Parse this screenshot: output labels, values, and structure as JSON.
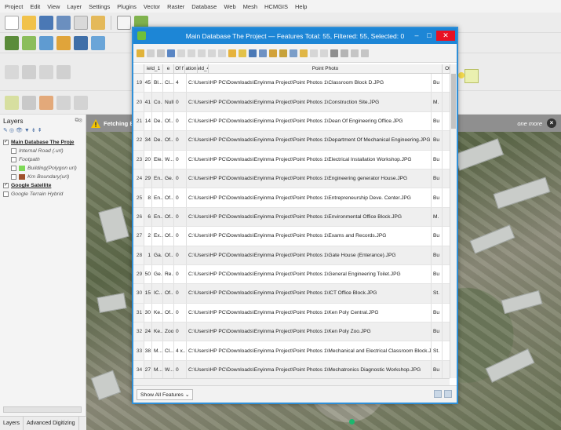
{
  "menubar": [
    "Project",
    "Edit",
    "View",
    "Layer",
    "Settings",
    "Plugins",
    "Vector",
    "Raster",
    "Database",
    "Web",
    "Mesh",
    "HCMGIS",
    "Help"
  ],
  "banner": {
    "text": "Fetching Ex",
    "more": "one more"
  },
  "layers": {
    "title": "Layers",
    "items": [
      {
        "label": "Main Database The Proje",
        "style": "bold",
        "checked": true,
        "swatch": ""
      },
      {
        "label": "Internal Road (.url)",
        "style": "italic",
        "checked": false,
        "swatch": ""
      },
      {
        "label": "Footpath",
        "style": "italic",
        "checked": false,
        "swatch": ""
      },
      {
        "label": "Building(Polygon url)",
        "style": "italic",
        "checked": false,
        "swatch": "#7ed957"
      },
      {
        "label": "Km Boundary(url)",
        "style": "italic",
        "checked": false,
        "swatch": "#a0522d"
      },
      {
        "label": "Google Satellite",
        "style": "bold",
        "checked": true,
        "swatch": ""
      },
      {
        "label": "Google Terrain Hybrid",
        "style": "italic",
        "checked": false,
        "swatch": ""
      }
    ],
    "tabs": [
      "Layers",
      "Advanced Digitizing"
    ]
  },
  "window": {
    "title": "Main Database The Project — Features Total: 55, Filtered: 55, Selected: 0",
    "columns": [
      "ield_1",
      "e",
      "Of f",
      "ation",
      "ield_4",
      "Point Photo",
      "Of"
    ],
    "rows": [
      {
        "num": "19",
        "id": "45",
        "name": "Bl...",
        "f": "Cl...",
        "loc": "4",
        "photo": "C:\\Users\\HP PC\\Downloads\\Enyinma Project\\Point Photos 1\\Classroom Block D.JPG",
        "of": "Bu"
      },
      {
        "num": "20",
        "id": "41",
        "name": "Co...",
        "f": "Null",
        "loc": "0",
        "photo": "C:\\Users\\HP PC\\Downloads\\Enyinma Project\\Point Photos 1\\Construction Site.JPG",
        "of": "M."
      },
      {
        "num": "21",
        "id": "14",
        "name": "De...",
        "f": "Of...",
        "loc": "0",
        "photo": "C:\\Users\\HP PC\\Downloads\\Enyinma Project\\Point Photos 1\\Dean Of Engineering Office.JPG",
        "of": "Bu"
      },
      {
        "num": "22",
        "id": "34",
        "name": "De...",
        "f": "Of...",
        "loc": "0",
        "photo": "C:\\Users\\HP PC\\Downloads\\Enyinma Project\\Point Photos 1\\Department Of Mechanical Engineering.JPG",
        "of": "Bu"
      },
      {
        "num": "23",
        "id": "20",
        "name": "Ele...",
        "f": "W...",
        "loc": "0",
        "photo": "C:\\Users\\HP PC\\Downloads\\Enyinma Project\\Point Photos 1\\Electrical Installation Workshop.JPG",
        "of": "Bu"
      },
      {
        "num": "24",
        "id": "29",
        "name": "En...",
        "f": "Ge...",
        "loc": "0",
        "photo": "C:\\Users\\HP PC\\Downloads\\Enyinma Project\\Point Photos 1\\Engineering generator House.JPG",
        "of": "Bu"
      },
      {
        "num": "25",
        "id": "8",
        "name": "En...",
        "f": "Of...",
        "loc": "0",
        "photo": "C:\\Users\\HP PC\\Downloads\\Enyinma Project\\Point Photos 1\\Entrepreneurship Deve. Center.JPG",
        "of": "Bu"
      },
      {
        "num": "26",
        "id": "6",
        "name": "En...",
        "f": "Of...",
        "loc": "0",
        "photo": "C:\\Users\\HP PC\\Downloads\\Enyinma Project\\Point Photos 1\\Environmental Office Block.JPG",
        "of": "M."
      },
      {
        "num": "27",
        "id": "2",
        "name": "Ex...",
        "f": "Of...",
        "loc": "0",
        "photo": "C:\\Users\\HP PC\\Downloads\\Enyinma Project\\Point Photos 1\\Exams and Records.JPG",
        "of": "Bu"
      },
      {
        "num": "28",
        "id": "1",
        "name": "Ga...",
        "f": "Of...",
        "loc": "0",
        "photo": "C:\\Users\\HP PC\\Downloads\\Enyinma Project\\Point Photos 1\\Gate House (Enterance).JPG",
        "of": "Bu"
      },
      {
        "num": "29",
        "id": "50",
        "name": "Ge...",
        "f": "Re...",
        "loc": "0",
        "photo": "C:\\Users\\HP PC\\Downloads\\Enyinma Project\\Point Photos 1\\General Engineering Toilet.JPG",
        "of": "Bu"
      },
      {
        "num": "30",
        "id": "15",
        "name": "IC...",
        "f": "Of...",
        "loc": "0",
        "photo": "C:\\Users\\HP PC\\Downloads\\Enyinma Project\\Point Photos 1\\ICT Office Block.JPG",
        "of": "St."
      },
      {
        "num": "31",
        "id": "30",
        "name": "Ke...",
        "f": "Of...",
        "loc": "0",
        "photo": "C:\\Users\\HP PC\\Downloads\\Enyinma Project\\Point Photos 1\\Ken Poly Central.JPG",
        "of": "Bu"
      },
      {
        "num": "32",
        "id": "24",
        "name": "Ke...",
        "f": "Zoo",
        "loc": "0",
        "photo": "C:\\Users\\HP PC\\Downloads\\Enyinma Project\\Point Photos 1\\Ken Poly Zoo.JPG",
        "of": "Bu"
      },
      {
        "num": "33",
        "id": "38",
        "name": "M...",
        "f": "Cl...",
        "loc": "4 x...",
        "photo": "C:\\Users\\HP PC\\Downloads\\Enyinma Project\\Point Photos 1\\Mechanical and Electrical Classroom Block.JPG",
        "of": "St."
      },
      {
        "num": "34",
        "id": "27",
        "name": "M...",
        "f": "W...",
        "loc": "0",
        "photo": "C:\\Users\\HP PC\\Downloads\\Enyinma Project\\Point Photos 1\\Mechatronics Diagnostic Workshop.JPG",
        "of": "Bu"
      }
    ],
    "show_all": "Show All Features"
  },
  "colors": {
    "accent": "#1d86d6",
    "close": "#e81123"
  }
}
